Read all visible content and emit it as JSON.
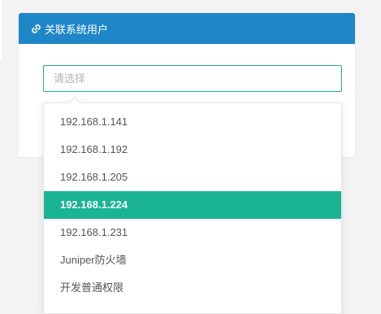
{
  "panel": {
    "title": "关联系统用户",
    "header_color": "#1f86c8"
  },
  "select": {
    "placeholder": "请选择",
    "accent_color": "#1ab394"
  },
  "dropdown": {
    "options": [
      {
        "label": "192.168.1.141",
        "selected": false
      },
      {
        "label": "192.168.1.192",
        "selected": false
      },
      {
        "label": "192.168.1.205",
        "selected": false
      },
      {
        "label": "192.168.1.224",
        "selected": true
      },
      {
        "label": "192.168.1.231",
        "selected": false
      },
      {
        "label": "Juniper防火墙",
        "selected": false
      },
      {
        "label": "开发普通权限",
        "selected": false
      }
    ]
  },
  "icons": {
    "header_icon": "link-icon"
  }
}
